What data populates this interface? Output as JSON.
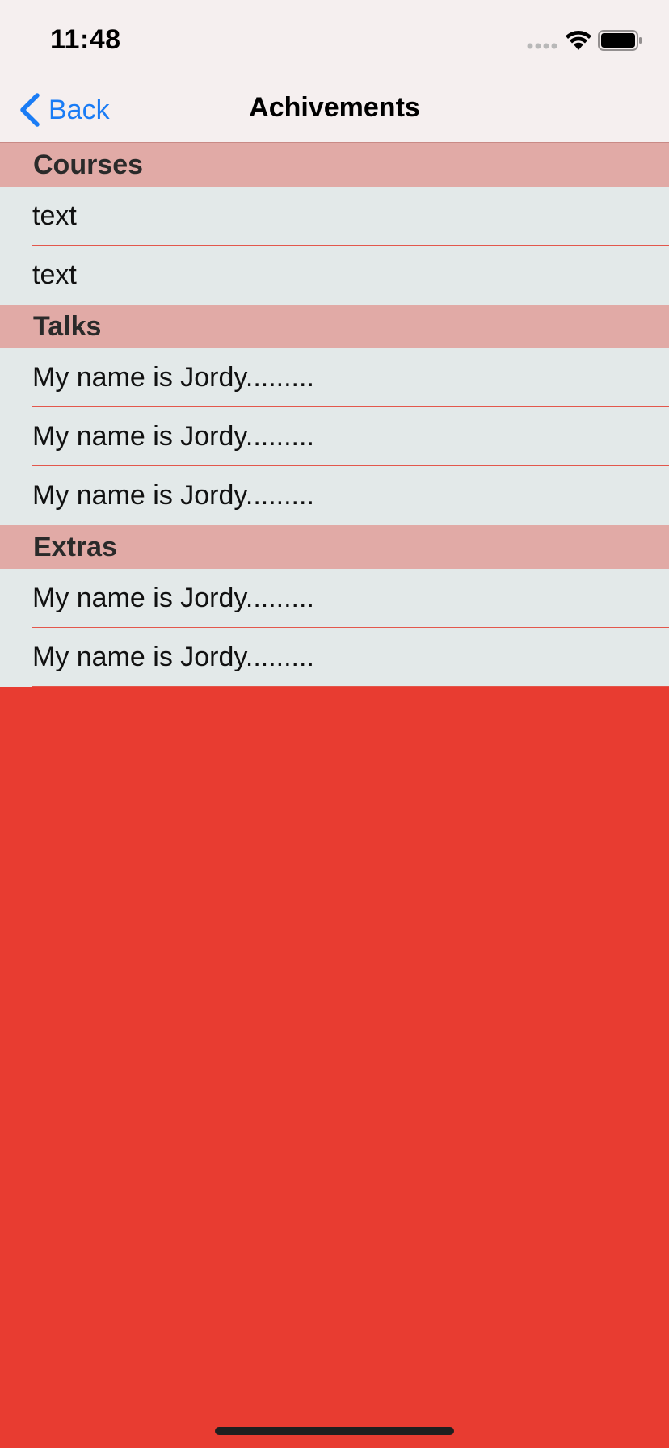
{
  "status_bar": {
    "time": "11:48"
  },
  "nav": {
    "back_label": "Back",
    "title": "Achivements"
  },
  "sections": {
    "courses": {
      "title": "Courses",
      "rows": [
        "text",
        "text"
      ]
    },
    "talks": {
      "title": "Talks",
      "rows": [
        "My name is Jordy.........",
        "My name is Jordy.........",
        "My name is Jordy........."
      ]
    },
    "extras": {
      "title": "Extras",
      "rows": [
        "My name is Jordy.........",
        "My name is Jordy........."
      ]
    }
  },
  "colors": {
    "background": "#e83c31",
    "header_background": "#e1aaa6",
    "row_background": "#e3e9e9",
    "separator": "#e3574c",
    "accent": "#1a7cf5"
  },
  "icons": {
    "back": "chevron-left-icon",
    "wifi": "wifi-icon",
    "battery": "battery-icon",
    "signal": "signal-icon"
  }
}
